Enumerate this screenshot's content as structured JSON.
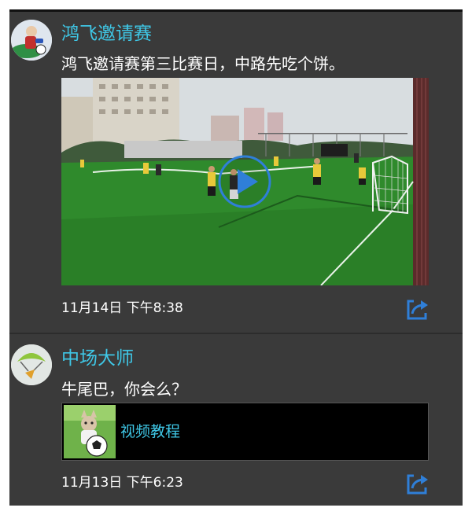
{
  "posts": [
    {
      "author": "鸿飞邀请赛",
      "text": "鸿飞邀请赛第三比赛日，中路先吃个饼。",
      "time": "11月14日 下午8:38",
      "attachment": "video"
    },
    {
      "author": "中场大师",
      "text": "牛尾巴，你会么？",
      "time": "11月13日 下午6:23",
      "attachment": "link",
      "link_title": "视频教程"
    }
  ],
  "icons": {
    "play": "play-icon",
    "share": "share-icon"
  },
  "colors": {
    "panel_bg": "#3a3a3a",
    "accent": "#3fc7e6",
    "share_icon": "#2f7fd8",
    "text": "#ffffff"
  }
}
